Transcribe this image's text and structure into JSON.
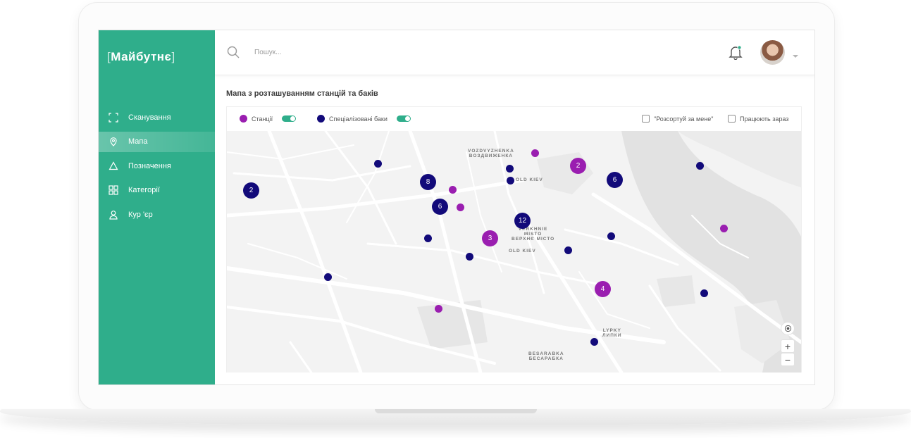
{
  "brand": {
    "name": "Майбутнє",
    "bracket_left": "[",
    "bracket_right": "]"
  },
  "colors": {
    "accent": "#2fae8b",
    "station": "#9a1eb0",
    "tank": "#120a7a"
  },
  "sidebar": {
    "items": [
      {
        "label": "Сканування",
        "icon": "scan-icon",
        "active": false
      },
      {
        "label": "Мапа",
        "icon": "map-pin-icon",
        "active": true
      },
      {
        "label": "Позначення",
        "icon": "recycle-triangle-icon",
        "active": false
      },
      {
        "label": "Категорії",
        "icon": "grid-icon",
        "active": false
      },
      {
        "label": "Кур 'єр",
        "icon": "user-icon",
        "active": false
      }
    ]
  },
  "header": {
    "search": {
      "placeholder": "Пошук...",
      "value": ""
    },
    "notification_icon": "bell-icon"
  },
  "content": {
    "title": "Мапа з розташуванням станцій та баків",
    "filters": {
      "stations_label": "Станції",
      "stations_enabled": true,
      "tanks_label": "Спеціалізовані баки",
      "tanks_enabled": true,
      "sort_label": "\"Розсортуй за мене\"",
      "sort_checked": false,
      "open_now_label": "Працюють зараз",
      "open_now_checked": false
    },
    "map_labels": {
      "vozdvyzhenka": "VOZDVYZHENKA",
      "vozdvyzhenka_ua": "ВОЗДВИЖЕНКА",
      "old_kiev": "OLD KIEV",
      "verkhnie": "VERKHNIE",
      "misto": "MISTO",
      "verkhnie_ua": "ВЕРХНЄ МІСТО",
      "lypky": "LYPKY",
      "lypky_ua": "ЛИПКИ",
      "besarabka": "BESARABKA",
      "besarabka_ua": "БЕСАРАБКА"
    },
    "map_controls": {
      "zoom_in": "+",
      "zoom_out": "−"
    },
    "clusters": [
      {
        "type": "tank",
        "count": "2"
      },
      {
        "type": "tank",
        "count": "8"
      },
      {
        "type": "tank",
        "count": "6"
      },
      {
        "type": "tank",
        "count": "12"
      },
      {
        "type": "station",
        "count": "3"
      },
      {
        "type": "station",
        "count": "2"
      },
      {
        "type": "tank",
        "count": "6"
      },
      {
        "type": "station",
        "count": "4"
      }
    ]
  }
}
